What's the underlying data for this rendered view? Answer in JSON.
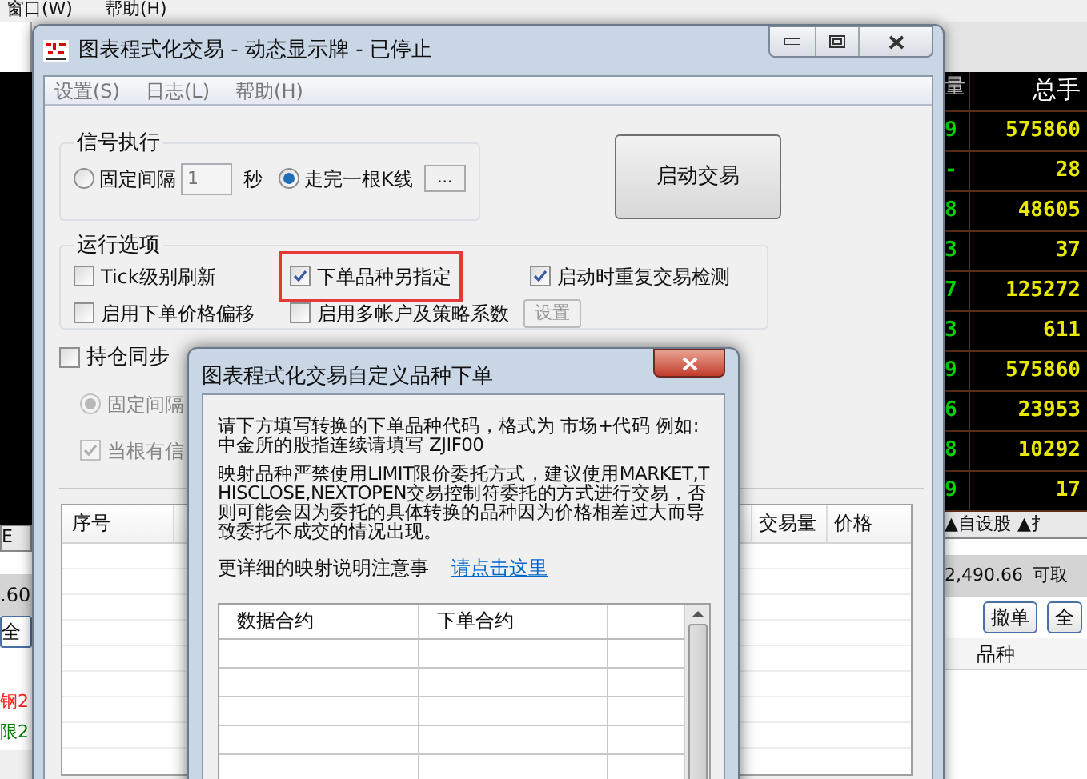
{
  "background_app": {
    "menu": [
      "窗口(W)",
      "帮助(H)"
    ],
    "left_strip": {
      "tab": "E",
      "value": ".60",
      "button": "全",
      "rows": [
        {
          "text": "钢2",
          "color": "#ff2020"
        },
        {
          "text": "限2",
          "color": "#008000"
        }
      ]
    },
    "quote_table": {
      "header_cut": "量",
      "header": "总手",
      "rows": [
        {
          "column_1": "9",
          "total": "575860"
        },
        {
          "column_1": "-",
          "total": "28"
        },
        {
          "column_1": "8",
          "total": "48605"
        },
        {
          "column_1": "3",
          "total": "37"
        },
        {
          "column_1": "7",
          "total": "125272"
        },
        {
          "column_1": "3",
          "total": "611"
        },
        {
          "column_1": "9",
          "total": "575860"
        },
        {
          "column_1": "6",
          "total": "23953"
        },
        {
          "column_1": "8",
          "total": "10292"
        },
        {
          "column_1": "9",
          "total": "17"
        }
      ]
    },
    "tabs": [
      "▲自设股",
      "▲扌"
    ],
    "balance": {
      "value": "2,490.66",
      "label": "可取"
    },
    "buttons": [
      "撤单",
      "全"
    ],
    "order_header": "品种"
  },
  "main_window": {
    "title": "图表程式化交易 - 动态显示牌 - 已停止",
    "menu": [
      "设置(S)",
      "日志(L)",
      "帮助(H)"
    ],
    "signal_group": {
      "title": "信号执行",
      "radios": [
        {
          "label": "固定间隔",
          "selected": false
        },
        {
          "label": "走完一根K线",
          "selected": true
        }
      ],
      "interval_value": "1",
      "unit": "秒",
      "more_button": "..."
    },
    "start_button": "启动交易",
    "options_group": {
      "title": "运行选项",
      "checkboxes": [
        {
          "label": "Tick级别刷新",
          "checked": false,
          "highlighted": false
        },
        {
          "label": "下单品种另指定",
          "checked": true,
          "highlighted": true
        },
        {
          "label": "启动时重复交易检测",
          "checked": true,
          "highlighted": false
        },
        {
          "label": "启用下单价格偏移",
          "checked": false,
          "highlighted": false
        },
        {
          "label": "启用多帐户及策略系数",
          "checked": false,
          "highlighted": false
        }
      ],
      "settings_button": {
        "label": "设置",
        "disabled": true
      }
    },
    "sync": {
      "label": "持仓同步",
      "checked": false,
      "radio": {
        "label": "固定间隔",
        "selected": true,
        "disabled": true
      },
      "checkbox": {
        "label": "当根有信",
        "checked": true,
        "disabled": true
      }
    },
    "table": {
      "columns": [
        "序号",
        "交易量",
        "价格"
      ]
    }
  },
  "dialog": {
    "title": "图表程式化交易自定义品种下单",
    "paragraphs": [
      "请下方填写转换的下单品种代码，格式为 市场+代码 例如:\n中金所的股指连续请填写 ZJIF00",
      "映射品种严禁使用LIMIT限价委托方式，建议使用MARKET,THISCLOSE,NEXTOPEN交易控制符委托的方式进行交易，否则可能会因为委托的具体转换的品种因为价格相差过大而导致委托不成交的情况出现。"
    ],
    "more_text": "更详细的映射说明注意事",
    "link": "请点击这里",
    "table": {
      "columns": [
        "数据合约",
        "下单合约"
      ]
    }
  }
}
